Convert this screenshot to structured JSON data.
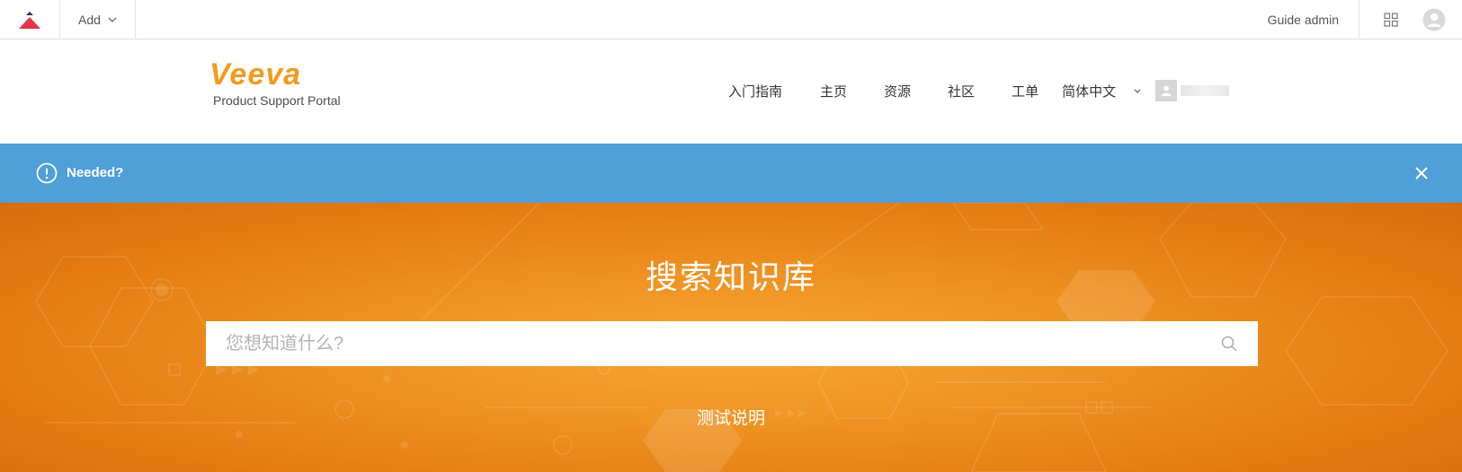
{
  "admin_bar": {
    "add_label": "Add",
    "guide_admin_label": "Guide admin"
  },
  "brand": {
    "name": "Veeva",
    "subtitle": "Product Support Portal",
    "color": "#f39a1f"
  },
  "nav": {
    "items": [
      {
        "label": "入门指南"
      },
      {
        "label": "主页"
      },
      {
        "label": "资源"
      },
      {
        "label": "社区"
      },
      {
        "label": "工单"
      }
    ],
    "language": "简体中文"
  },
  "banner": {
    "text": "Needed?",
    "color": "#4f9fd8"
  },
  "hero": {
    "title": "搜索知识库",
    "search_placeholder": "您想知道什么?",
    "link": "测试说明"
  }
}
